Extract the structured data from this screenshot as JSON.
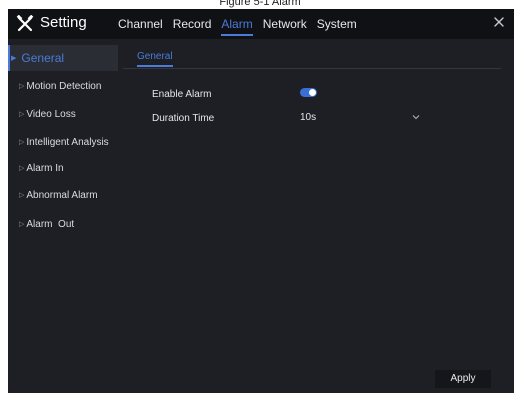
{
  "caption": "Figure 5-1 Alarm",
  "header": {
    "title": "Setting",
    "nav": [
      "Channel",
      "Record",
      "Alarm",
      "Network",
      "System"
    ],
    "active_nav": "Alarm"
  },
  "sidebar": {
    "items": [
      {
        "label": "General",
        "active": true
      },
      {
        "label": "Motion Detection"
      },
      {
        "label": "Video Loss"
      },
      {
        "label": "Intelligent Analysis"
      },
      {
        "label": "Alarm In"
      },
      {
        "label": "Abnormal Alarm"
      },
      {
        "label": "Alarm  Out"
      }
    ]
  },
  "main": {
    "subtab": "General",
    "fields": {
      "enable_alarm": {
        "label": "Enable Alarm",
        "value": "on"
      },
      "duration_time": {
        "label": "Duration Time",
        "value": "10s"
      }
    },
    "apply_label": "Apply"
  },
  "colors": {
    "accent": "#4a7bd8",
    "background": "#1e1f24",
    "header": "#101115"
  },
  "icons": {
    "app": "tools-icon",
    "close": "close-icon",
    "dropdown": "chevron-down-icon"
  }
}
